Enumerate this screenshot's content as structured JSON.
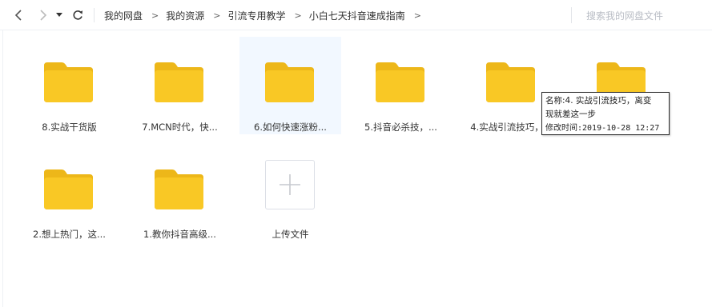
{
  "toolbar": {
    "back_icon": "chevron-left-icon",
    "forward_icon": "chevron-right-icon",
    "dropdown_icon": "caret-down-icon",
    "refresh_icon": "refresh-icon"
  },
  "breadcrumb": {
    "items": [
      "我的网盘",
      "我的资源",
      "引流专用教学",
      "小白七天抖音速成指南"
    ],
    "separator": ">"
  },
  "search": {
    "placeholder": "搜索我的网盘文件",
    "value": ""
  },
  "folders": [
    {
      "label": "8.实战干货版"
    },
    {
      "label": "7.MCN时代，快..."
    },
    {
      "label": "6.如何快速涨粉..."
    },
    {
      "label": "5.抖音必杀技，..."
    },
    {
      "label": "4.实战引流技巧，..."
    },
    {
      "label": ""
    },
    {
      "label": "2.想上热门，这..."
    },
    {
      "label": "1.教你抖音高级..."
    }
  ],
  "upload": {
    "label": "上传文件",
    "icon": "plus-icon"
  },
  "tooltip": {
    "line1": "名称:4. 实战引流技巧，离变",
    "line2": "现就差这一步",
    "line3": "修改时间:2019-10-28 12:27"
  },
  "colors": {
    "folder": "#F9C825",
    "folder_tab": "#EDB719",
    "hover_bg": "#F2F8FF",
    "accent": "#333333"
  }
}
